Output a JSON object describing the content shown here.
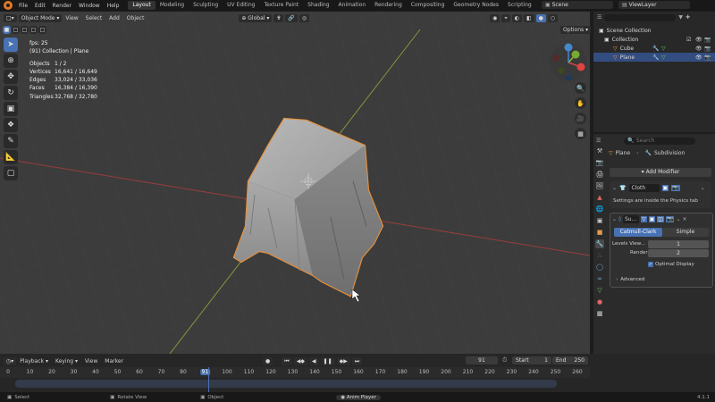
{
  "topbar": {
    "menus": [
      "File",
      "Edit",
      "Render",
      "Window",
      "Help"
    ],
    "workspaces": [
      "Layout",
      "Modeling",
      "Sculpting",
      "UV Editing",
      "Texture Paint",
      "Shading",
      "Animation",
      "Rendering",
      "Compositing",
      "Geometry Nodes",
      "Scripting"
    ],
    "active_workspace": "Layout",
    "scene": "Scene",
    "view_layer": "ViewLayer"
  },
  "viewport_header": {
    "mode": "Object Mode",
    "menus": [
      "View",
      "Select",
      "Add",
      "Object"
    ],
    "orientation": "Global",
    "options": "Options"
  },
  "stats": {
    "fps": "fps: 25",
    "context": "(91) Collection | Plane",
    "rows": [
      {
        "k": "Objects",
        "v": "1 / 2"
      },
      {
        "k": "Vertices",
        "v": "16,641 / 16,649"
      },
      {
        "k": "Edges",
        "v": "33,024 / 33,036"
      },
      {
        "k": "Faces",
        "v": "16,384 / 16,390"
      },
      {
        "k": "Triangles",
        "v": "32,768 / 32,780"
      }
    ]
  },
  "outliner": {
    "search_placeholder": "",
    "items": [
      {
        "label": "Scene Collection",
        "indent": 0,
        "selected": false
      },
      {
        "label": "Collection",
        "indent": 1,
        "selected": false
      },
      {
        "label": "Cube",
        "indent": 2,
        "selected": false
      },
      {
        "label": "Plane",
        "indent": 2,
        "selected": true
      }
    ]
  },
  "properties": {
    "search_placeholder": "Search",
    "object_name": "Plane",
    "modifier_crumb": "Subdivision",
    "add_modifier": "Add Modifier",
    "cloth": {
      "name": "Cloth",
      "note": "Settings are inside the Physics tab"
    },
    "subsurf": {
      "name": "Su...",
      "type_a": "Catmull-Clark",
      "type_b": "Simple",
      "levels_label": "Levels View...",
      "levels_value": "1",
      "render_label": "Render",
      "render_value": "2",
      "optimal_label": "Optimal Display",
      "advanced_label": "Advanced"
    }
  },
  "timeline": {
    "menus": [
      "Playback",
      "Keying",
      "View",
      "Marker"
    ],
    "current_frame": "91",
    "start_label": "Start",
    "start_value": "1",
    "end_label": "End",
    "end_value": "250",
    "ticks": [
      "0",
      "10",
      "20",
      "30",
      "40",
      "50",
      "60",
      "70",
      "80",
      "91",
      "100",
      "110",
      "120",
      "130",
      "140",
      "150",
      "160",
      "170",
      "180",
      "190",
      "200",
      "210",
      "220",
      "230",
      "240",
      "250",
      "260"
    ]
  },
  "statusbar": {
    "select": "Select",
    "rotate": "Rotate View",
    "object": "Object",
    "anim": "Anim Player",
    "version": "4.1.1"
  },
  "colors": {
    "accent": "#4772b3",
    "selection_outline": "#e8903a",
    "x_axis": "#a04040",
    "y_axis": "#8a9a3a"
  }
}
